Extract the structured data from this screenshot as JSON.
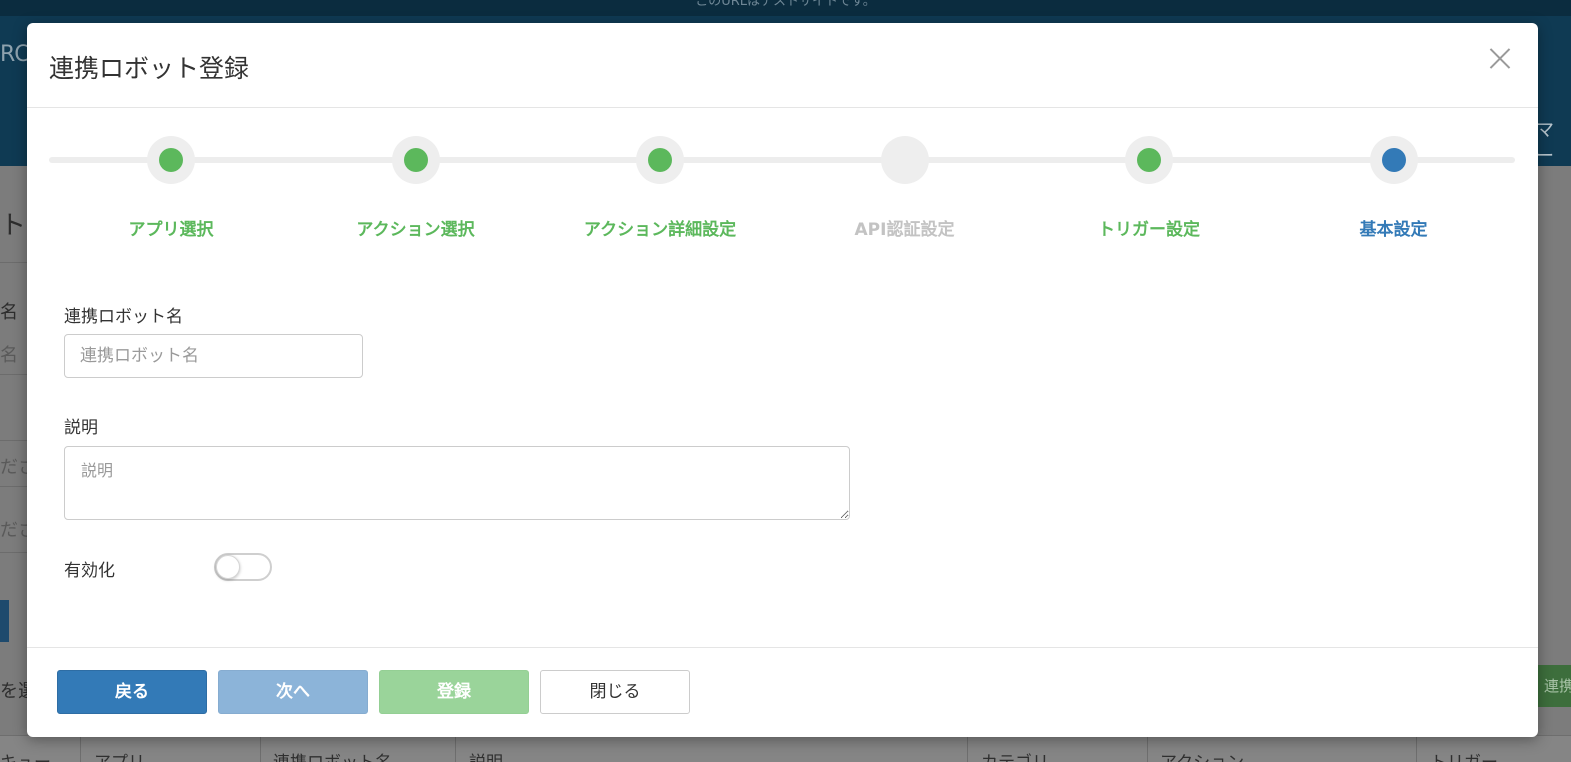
{
  "background": {
    "top_banner": "このURLはテストサイトです。",
    "logo": "RC",
    "menu_right": "マー",
    "side_fragments": [
      "ト",
      "名",
      "名",
      "ださい",
      "ださい",
      "を選"
    ],
    "right_button": "連携",
    "table_headers": [
      "キュー",
      "アプリ",
      "連携ロボット名",
      "説明",
      "カテゴリ",
      "アクション",
      "トリガー"
    ]
  },
  "modal": {
    "title": "連携ロボット登録",
    "close_icon": "close-icon",
    "steps": [
      {
        "label": "アプリ選択",
        "state": "done"
      },
      {
        "label": "アクション選択",
        "state": "done"
      },
      {
        "label": "アクション詳細設定",
        "state": "done"
      },
      {
        "label": "API認証設定",
        "state": "skipped"
      },
      {
        "label": "トリガー設定",
        "state": "done"
      },
      {
        "label": "基本設定",
        "state": "current"
      }
    ],
    "colors": {
      "done": "#5cb85c",
      "skipped": "#c3c3c3",
      "current": "#337ab7"
    },
    "form": {
      "robot_name_label": "連携ロボット名",
      "robot_name_value": "",
      "robot_name_placeholder": "連携ロボット名",
      "description_label": "説明",
      "description_value": "",
      "description_placeholder": "説明",
      "enable_label": "有効化",
      "enabled": false
    },
    "footer": {
      "back": "戻る",
      "next": "次へ",
      "register": "登録",
      "close": "閉じる"
    }
  }
}
